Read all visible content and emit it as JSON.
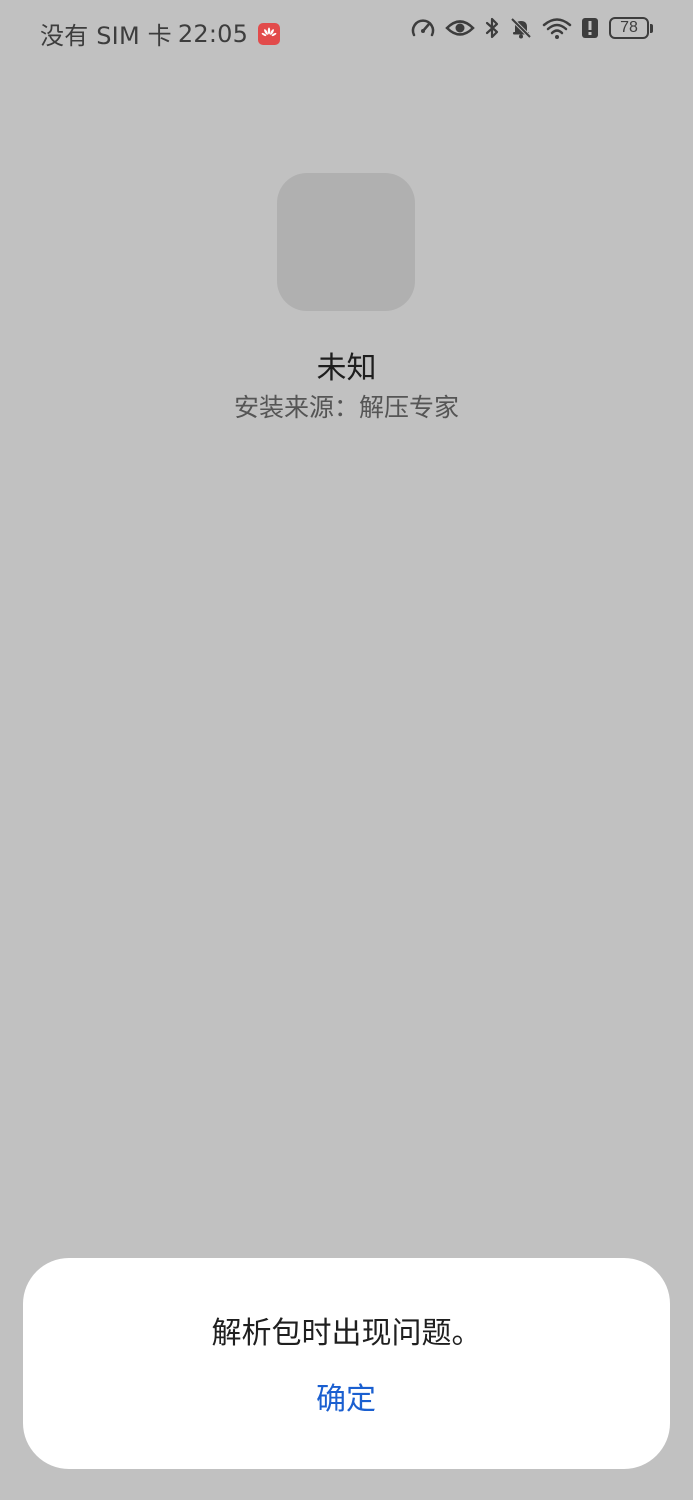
{
  "status_bar": {
    "carrier": "没有 SIM 卡",
    "time": "22:05",
    "battery_level": "78",
    "icons": [
      "huawei-app-icon",
      "speedometer-icon",
      "eye-icon",
      "bluetooth-icon",
      "bell-off-icon",
      "wifi-icon",
      "alert-icon",
      "battery-icon"
    ]
  },
  "app_info": {
    "name": "未知",
    "source": "安装来源：解压专家"
  },
  "dialog": {
    "message": "解析包时出现问题。",
    "confirm_label": "确定"
  },
  "colors": {
    "background": "#c1c1c1",
    "accent": "#1a5fd0",
    "badge": "#e24b4b"
  }
}
